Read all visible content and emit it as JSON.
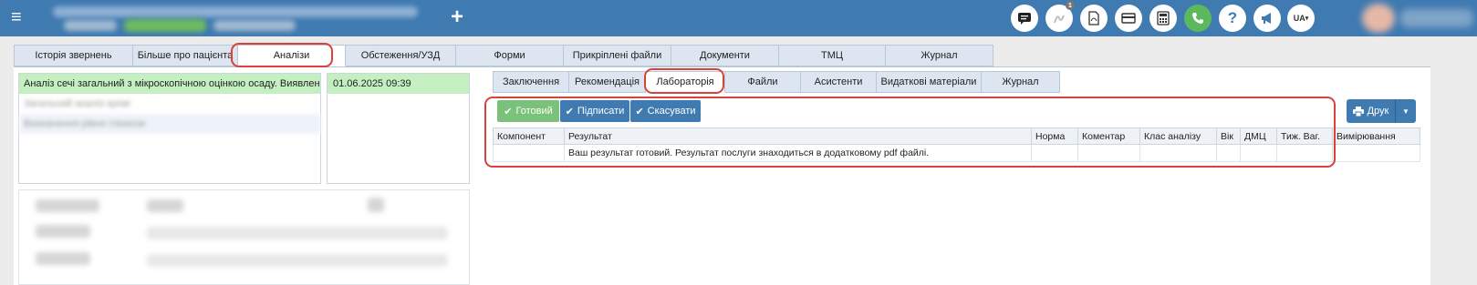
{
  "topbar": {
    "menu_icon": "hamburger-icon",
    "add_icon": "plus-icon",
    "add_label": "+",
    "notification_count": "1",
    "lang_label": "UA",
    "icons": [
      "chat-icon",
      "signature-icon",
      "pdf-icon",
      "card-icon",
      "calculator-icon",
      "phone-icon",
      "help-icon",
      "megaphone-icon",
      "language-icon"
    ]
  },
  "main_tabs": [
    {
      "label": "Історія звернень"
    },
    {
      "label": "Більше про пацієнта"
    },
    {
      "label": "Аналізи"
    },
    {
      "label": "Обстеження/УЗД"
    },
    {
      "label": "Форми"
    },
    {
      "label": "Прикріплені файли"
    },
    {
      "label": "Документи"
    },
    {
      "label": "ТМЦ"
    },
    {
      "label": "Журнал"
    }
  ],
  "analyses_list": {
    "selected_item": "Аналіз сечі загальний з мікроскопічною оцінкою осаду. Виявлення ...",
    "selected_date": "01.06.2025 09:39",
    "blurred_items": [
      "Загальний аналіз крові",
      "Визначення рівня глюкози"
    ]
  },
  "sub_tabs": [
    {
      "label": "Заключення"
    },
    {
      "label": "Рекомендація"
    },
    {
      "label": "Лабораторія"
    },
    {
      "label": "Файли"
    },
    {
      "label": "Асистенти"
    },
    {
      "label": "Видаткові матеріали"
    },
    {
      "label": "Журнал"
    }
  ],
  "actions": {
    "ready": "Готовий",
    "sign": "Підписати",
    "cancel": "Скасувати",
    "print": "Друк"
  },
  "results_table": {
    "columns": [
      "Компонент",
      "Результат",
      "Норма",
      "Коментар",
      "Клас аналізу",
      "Вік",
      "ДМЦ",
      "Тиж. Ваг.",
      "Вимірювання"
    ],
    "rows": [
      [
        "",
        "Ваш результат готовий. Результат послуги знаходиться в додатковому pdf файлі.",
        "",
        "",
        "",
        "",
        "",
        "",
        ""
      ]
    ]
  },
  "colors": {
    "topbar": "#3f7ab1",
    "highlight": "#d9413b",
    "selected_row": "#c4f0c1",
    "ready_button": "#7ac27a"
  }
}
